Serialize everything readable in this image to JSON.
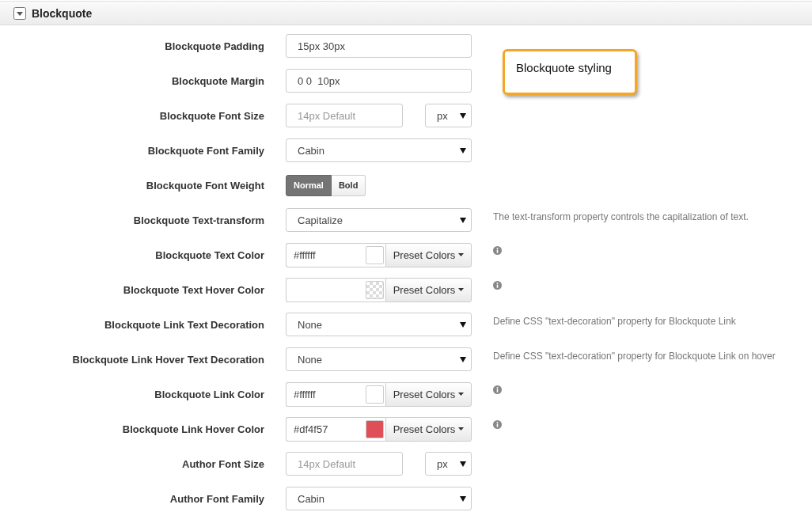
{
  "section": {
    "title": "Blockquote",
    "expanded": true
  },
  "callout": "Blockquote styling",
  "rows": [
    {
      "kind": "text",
      "label": "Blockquote Padding",
      "value": "15px 30px"
    },
    {
      "kind": "text",
      "label": "Blockquote Margin",
      "value": "0 0  10px"
    },
    {
      "kind": "size",
      "label": "Blockquote Font Size",
      "placeholder": "14px Default",
      "unit": "px"
    },
    {
      "kind": "select",
      "label": "Blockquote Font Family",
      "value": "Cabin"
    },
    {
      "kind": "toggle",
      "label": "Blockquote Font Weight",
      "options": [
        {
          "label": "Normal",
          "selected": true
        },
        {
          "label": "Bold",
          "selected": false
        }
      ]
    },
    {
      "kind": "select",
      "label": "Blockquote Text-transform",
      "value": "Capitalize",
      "help": "The text-transform property controls the capitalization of text."
    },
    {
      "kind": "color",
      "label": "Blockquote Text Color",
      "value": "#ffffff",
      "color": "#ffffff",
      "button": "Preset Colors"
    },
    {
      "kind": "color",
      "label": "Blockquote Text Hover Color",
      "button": "Preset Colors"
    },
    {
      "kind": "select",
      "label": "Blockquote Link Text Decoration",
      "value": "None",
      "help": "Define CSS \"text-decoration\" property for Blockquote Link"
    },
    {
      "kind": "select",
      "label": "Blockquote Link Hover Text Decoration",
      "value": "None",
      "help": "Define CSS \"text-decoration\" property for Blockquote Link on hover"
    },
    {
      "kind": "color",
      "label": "Blockquote Link Color",
      "value": "#ffffff",
      "color": "#ffffff",
      "button": "Preset Colors"
    },
    {
      "kind": "color",
      "label": "Blockquote Link Hover Color",
      "value": "#df4f57",
      "color": "#df4f57",
      "button": "Preset Colors"
    },
    {
      "kind": "size",
      "label": "Author Font Size",
      "placeholder": "14px Default",
      "unit": "px"
    },
    {
      "kind": "select",
      "label": "Author Font Family",
      "value": "Cabin"
    }
  ]
}
